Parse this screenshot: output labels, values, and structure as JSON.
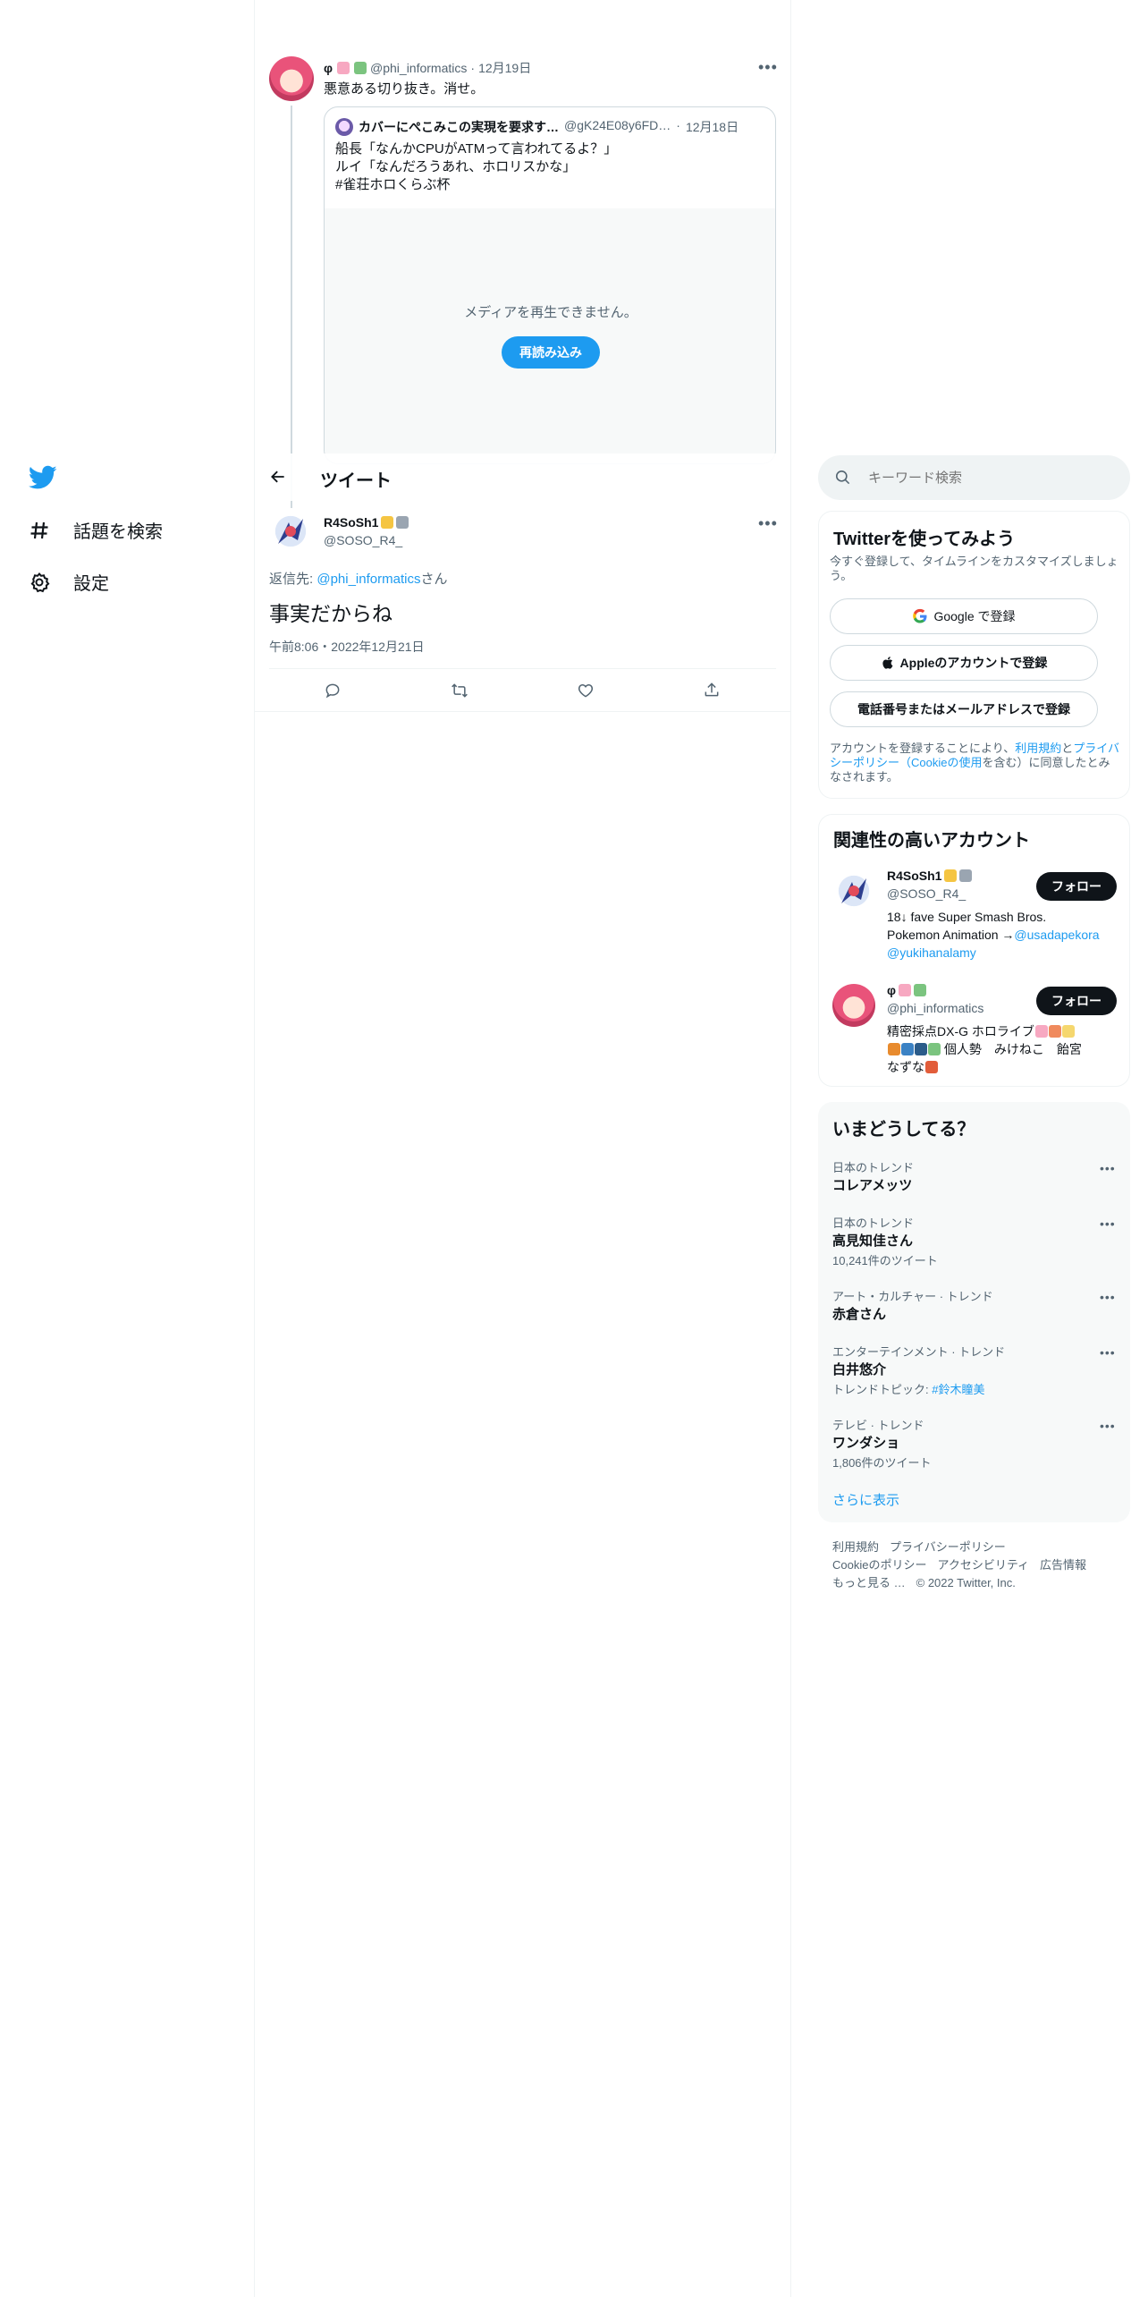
{
  "nav": {
    "explore_label": "話題を検索",
    "settings_label": "設定"
  },
  "header": {
    "back_icon": "arrow-left-icon",
    "title": "ツイート"
  },
  "parent_tweet": {
    "name": "φ",
    "handle": "@phi_informatics",
    "date": "12月19日",
    "text": "悪意ある切り抜き。消せ。",
    "quoted": {
      "name": "カバーにぺこみこの実現を要求す…",
      "handle": "@gK24E08y6FD…",
      "date": "12月18日",
      "lines": [
        "船長「なんかCPUがATMって言われてるよ？」",
        "ルイ「なんだろうあれ、ホロリスかな」",
        "#雀荘ホロくらぶ杯"
      ],
      "media_error": "メディアを再生できません。",
      "reload_label": "再読み込み"
    }
  },
  "main_tweet": {
    "name": "R4SoSh1",
    "handle": "@SOSO_R4_",
    "reply_prefix": "返信先: ",
    "reply_to": "@phi_informatics",
    "reply_suffix": "さん",
    "text": "事実だからね",
    "timestamp": "午前8:06・2022年12月21日"
  },
  "search": {
    "placeholder": "キーワード検索"
  },
  "signup": {
    "title": "Twitterを使ってみよう",
    "subtitle": "今すぐ登録して、タイムラインをカスタマイズしましょう。",
    "google_label": "Google で登録",
    "apple_label": "Appleのアカウントで登録",
    "phone_label": "電話番号またはメールアドレスで登録",
    "terms_prefix": "アカウントを登録することにより、",
    "terms_link1": "利用規約",
    "terms_and": "と",
    "terms_link2": "プライバシーポリシー（Cookieの使用",
    "terms_suffix": "を含む）に同意したとみなされます。"
  },
  "related": {
    "title": "関連性の高いアカウント",
    "follow_label": "フォロー",
    "accounts": [
      {
        "name": "R4SoSh1",
        "handle": "@SOSO_R4_",
        "bio_line1": "18↓ fave Super Smash Bros.",
        "bio_line2_text": "Pokemon Animation →",
        "bio_line2_link": "@usadapekora",
        "bio_line3_link": "@yukihanalamy"
      },
      {
        "name": "φ",
        "handle": "@phi_informatics",
        "bio_line1": "精密採点DX-G ホロライブ",
        "bio_line2": " 個人勢　みけねこ　飴宮",
        "bio_line3": "なずな"
      }
    ]
  },
  "trends": {
    "title": "いまどうしてる？",
    "items": [
      {
        "context": "日本のトレンド",
        "name": "コレアメッツ",
        "meta": ""
      },
      {
        "context": "日本のトレンド",
        "name": "高見知佳さん",
        "meta": "10,241件のツイート"
      },
      {
        "context": "アート・カルチャー · トレンド",
        "name": "赤倉さん",
        "meta": ""
      },
      {
        "context": "エンターテインメント · トレンド",
        "name": "白井悠介",
        "meta_prefix": "トレンドトピック: ",
        "meta_link": "#鈴木瞳美"
      },
      {
        "context": "テレビ · トレンド",
        "name": "ワンダショ",
        "meta": "1,806件のツイート"
      }
    ],
    "show_more": "さらに表示"
  },
  "footer": {
    "links_row1": [
      "利用規約",
      "プライバシーポリシー"
    ],
    "links_row2": [
      "Cookieのポリシー",
      "アクセシビリティ",
      "広告情報"
    ],
    "more": "もっと見る …",
    "copyright": "© 2022 Twitter, Inc."
  },
  "colors": {
    "accent": "#1d9bf0",
    "text": "#0f1419",
    "muted": "#536471",
    "panel_bg": "#f7f9f9",
    "border": "#eff3f4"
  }
}
